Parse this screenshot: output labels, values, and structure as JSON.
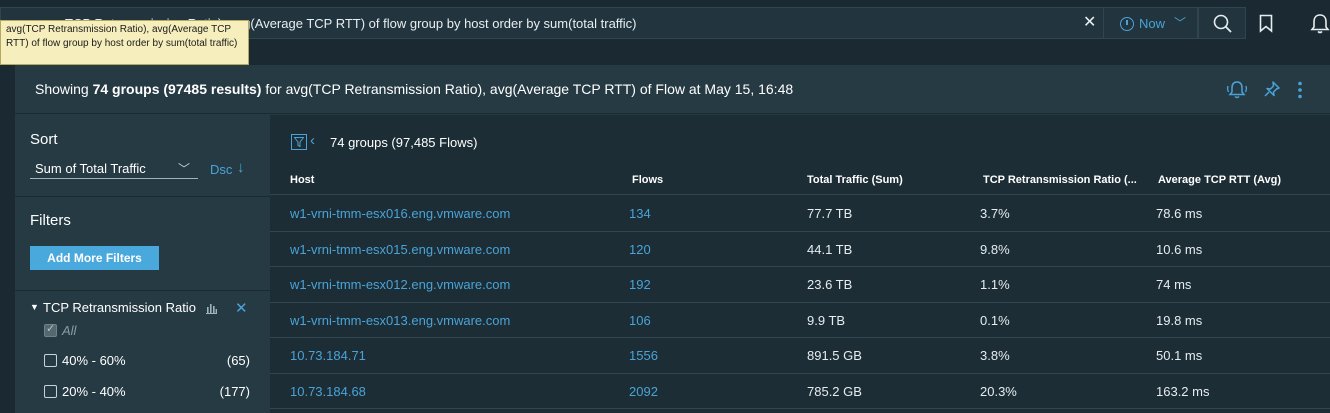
{
  "search": {
    "query_visible": "TCP Retransmission Ratio), avg(Average TCP RTT)  of flow group by host order by sum(total traffic)",
    "clear_icon": "close-icon",
    "time_label": "Now",
    "tooltip": "avg(TCP Retransmission Ratio), avg(Average TCP RTT)  of flow group by host order by sum(total traffic)"
  },
  "panel": {
    "title_prefix": "Showing ",
    "title_groups": "74 groups (97485 results)",
    "title_suffix": " for avg(TCP Retransmission Ratio), avg(Average TCP RTT) of Flow at May 15, 16:48"
  },
  "sidebar": {
    "sort_label": "Sort",
    "sort_value": "Sum of Total Traffic",
    "sort_order": "Dsc",
    "filters_label": "Filters",
    "add_filters": "Add More Filters",
    "filter_name": "TCP Retransmission Ratio",
    "options": [
      {
        "label": "All",
        "count": "",
        "checked": true
      },
      {
        "label": "40% - 60%",
        "count": "(65)",
        "checked": false
      },
      {
        "label": "20% - 40%",
        "count": "(177)",
        "checked": false
      }
    ]
  },
  "results": {
    "summary": "74 groups (97,485 Flows)",
    "columns": [
      "Host",
      "Flows",
      "Total Traffic (Sum)",
      "TCP Retransmission Ratio (...",
      "Average TCP RTT (Avg)"
    ],
    "rows": [
      [
        "w1-vrni-tmm-esx016.eng.vmware.com",
        "134",
        "77.7 TB",
        "3.7%",
        "78.6 ms"
      ],
      [
        "w1-vrni-tmm-esx015.eng.vmware.com",
        "120",
        "44.1 TB",
        "9.8%",
        "10.6 ms"
      ],
      [
        "w1-vrni-tmm-esx012.eng.vmware.com",
        "192",
        "23.6 TB",
        "1.1%",
        "74 ms"
      ],
      [
        "w1-vrni-tmm-esx013.eng.vmware.com",
        "106",
        "9.9 TB",
        "0.1%",
        "19.8 ms"
      ],
      [
        "10.73.184.71",
        "1556",
        "891.5 GB",
        "3.8%",
        "50.1 ms"
      ],
      [
        "10.73.184.68",
        "2092",
        "785.2 GB",
        "20.3%",
        "163.2 ms"
      ]
    ]
  },
  "colors": {
    "accent": "#4aa3d8",
    "background": "#1b2a32",
    "panel": "#263a44",
    "table_bg": "#1c2d35",
    "tooltip_bg": "#f6efbd"
  }
}
